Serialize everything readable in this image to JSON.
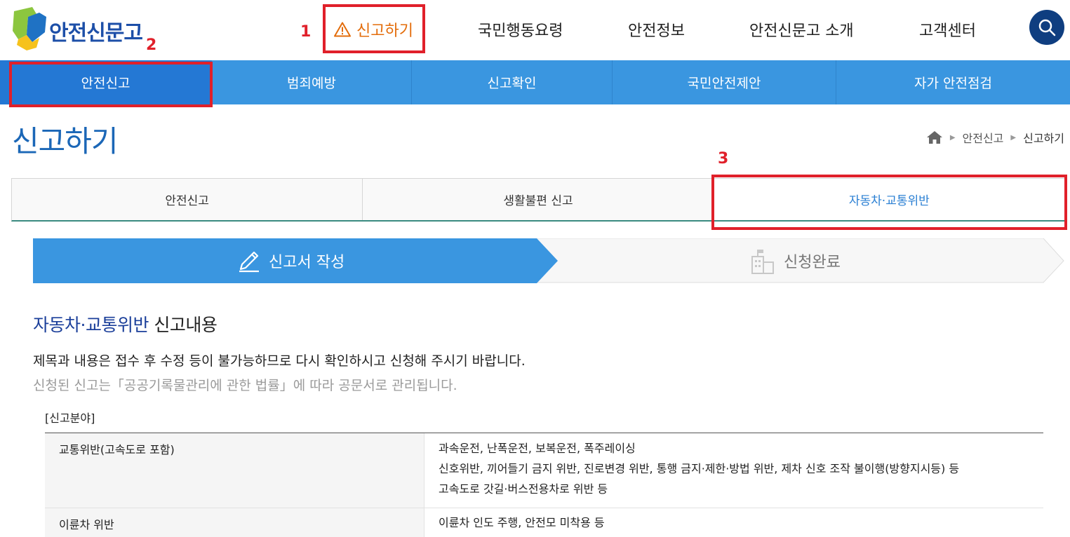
{
  "header": {
    "logo_text": "안전신문고",
    "nav": [
      {
        "label": "신고하기"
      },
      {
        "label": "국민행동요령"
      },
      {
        "label": "안전정보"
      },
      {
        "label": "안전신문고 소개"
      },
      {
        "label": "고객센터"
      }
    ],
    "search_icon": "search-icon"
  },
  "annotations": {
    "n1": "1",
    "n2": "2",
    "n3": "3"
  },
  "subnav": [
    {
      "label": "안전신고"
    },
    {
      "label": "범죄예방"
    },
    {
      "label": "신고확인"
    },
    {
      "label": "국민안전제안"
    },
    {
      "label": "자가 안전점검"
    }
  ],
  "page": {
    "title": "신고하기",
    "breadcrumb": [
      "안전신고",
      "신고하기"
    ]
  },
  "tabs": [
    {
      "label": "안전신고"
    },
    {
      "label": "생활불편 신고"
    },
    {
      "label": "자동차·교통위반"
    }
  ],
  "steps": [
    {
      "label": "신고서 작성"
    },
    {
      "label": "신청완료"
    }
  ],
  "content": {
    "section_title_em": "자동차·교통위반",
    "section_title_rest": " 신고내용",
    "notice1": "제목과 내용은 접수 후 수정 등이 불가능하므로 다시 확인하시고 신청해 주시기 바랍니다.",
    "notice2": "신청된 신고는「공공기록물관리에 관한 법률」에 따라 공문서로 관리됩니다.",
    "field_label": "[신고분야]",
    "table": [
      {
        "category": "교통위반(고속도로 포함)",
        "lines": [
          "과속운전, 난폭운전, 보복운전, 폭주레이싱",
          "신호위반, 끼어들기 금지 위반, 진로변경 위반, 통행 금지·제한·방법 위반, 제차 신호 조작 불이행(방향지시등) 등",
          "고속도로 갓길·버스전용차로 위반 등"
        ]
      },
      {
        "category": "이륜차 위반",
        "lines": [
          "이륜차 인도 주행, 안전모 미착용 등"
        ]
      }
    ]
  },
  "colors": {
    "brand_blue": "#1b67b7",
    "subnav_bg": "#3a96e0",
    "report_orange": "#e36c0a",
    "annotation_red": "#e0202a"
  }
}
